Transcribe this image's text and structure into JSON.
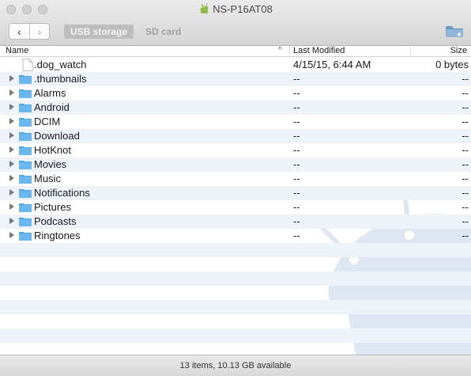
{
  "window": {
    "title": "NS-P16AT08"
  },
  "toolbar": {
    "back_label": "‹",
    "forward_label": "›",
    "storage_tabs": [
      {
        "label": "USB storage",
        "selected": true
      },
      {
        "label": "SD card",
        "selected": false
      }
    ],
    "new_folder_icon": "new-folder-icon"
  },
  "columns": {
    "name": "Name",
    "sort_indicator": "^",
    "last_modified": "Last Modified",
    "size": "Size"
  },
  "files": [
    {
      "name": ".dog_watch",
      "type": "file",
      "modified": "4/15/15, 6:44 AM",
      "size": "0 bytes"
    },
    {
      "name": ".thumbnails",
      "type": "folder",
      "modified": "--",
      "size": "--"
    },
    {
      "name": "Alarms",
      "type": "folder",
      "modified": "--",
      "size": "--"
    },
    {
      "name": "Android",
      "type": "folder",
      "modified": "--",
      "size": "--"
    },
    {
      "name": "DCIM",
      "type": "folder",
      "modified": "--",
      "size": "--"
    },
    {
      "name": "Download",
      "type": "folder",
      "modified": "--",
      "size": "--"
    },
    {
      "name": "HotKnot",
      "type": "folder",
      "modified": "--",
      "size": "--"
    },
    {
      "name": "Movies",
      "type": "folder",
      "modified": "--",
      "size": "--"
    },
    {
      "name": "Music",
      "type": "folder",
      "modified": "--",
      "size": "--"
    },
    {
      "name": "Notifications",
      "type": "folder",
      "modified": "--",
      "size": "--"
    },
    {
      "name": "Pictures",
      "type": "folder",
      "modified": "--",
      "size": "--"
    },
    {
      "name": "Podcasts",
      "type": "folder",
      "modified": "--",
      "size": "--"
    },
    {
      "name": "Ringtones",
      "type": "folder",
      "modified": "--",
      "size": "--"
    }
  ],
  "status": {
    "text": "13 items, 10.13 GB available"
  },
  "colors": {
    "folder": "#4aa8e8",
    "stripe": "#eef3fa",
    "android_watermark": "#dde6f1",
    "android_logo": "#8fbc4a"
  }
}
